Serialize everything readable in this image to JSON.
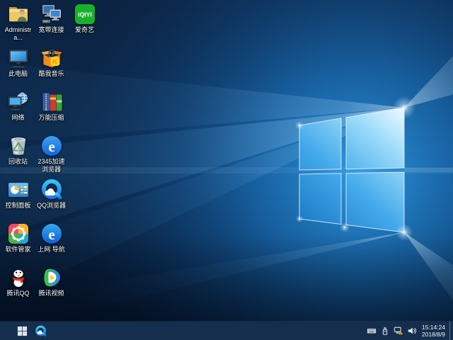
{
  "desktop": {
    "icons": [
      {
        "id": "user-folder",
        "label": "Administra...",
        "col": 0,
        "row": 0
      },
      {
        "id": "broadband",
        "label": "宽带连接",
        "col": 1,
        "row": 0
      },
      {
        "id": "iqiyi",
        "label": "爱奇艺",
        "badge_text": "iQIYI",
        "col": 2,
        "row": 0
      },
      {
        "id": "this-pc",
        "label": "此电脑",
        "col": 0,
        "row": 1
      },
      {
        "id": "kuwo-music",
        "label": "酷我音乐",
        "badge_text": "K",
        "col": 1,
        "row": 1
      },
      {
        "id": "network",
        "label": "网络",
        "col": 0,
        "row": 2
      },
      {
        "id": "wanneng-zip",
        "label": "万能压缩",
        "col": 1,
        "row": 2
      },
      {
        "id": "recycle-bin",
        "label": "回收站",
        "col": 0,
        "row": 3
      },
      {
        "id": "browser-2345",
        "label": "2345加速浏览器",
        "badge_text": "e",
        "col": 1,
        "row": 3
      },
      {
        "id": "control-panel",
        "label": "控制面板",
        "col": 0,
        "row": 4
      },
      {
        "id": "qq-browser",
        "label": "QQ浏览器",
        "col": 1,
        "row": 4
      },
      {
        "id": "software-manager",
        "label": "软件管家",
        "col": 0,
        "row": 5
      },
      {
        "id": "web-nav",
        "label": "上网 导航",
        "badge_text": "e",
        "col": 1,
        "row": 5
      },
      {
        "id": "tencent-qq",
        "label": "腾讯QQ",
        "col": 0,
        "row": 6
      },
      {
        "id": "tencent-video",
        "label": "腾讯视频",
        "col": 1,
        "row": 6
      }
    ]
  },
  "taskbar": {
    "start_tooltip": "开始",
    "pinned": [
      {
        "id": "qq-browser-task",
        "icon": "qq-browser"
      }
    ],
    "tray": {
      "icons": [
        {
          "id": "touch-keyboard"
        },
        {
          "id": "usb-device"
        },
        {
          "id": "network-warning"
        },
        {
          "id": "volume"
        }
      ],
      "clock": {
        "time": "15:14:24",
        "date": "2018/8/9"
      }
    }
  },
  "colors": {
    "taskbar_bg": "#152e4d",
    "wallpaper_accent": "#1e83d6",
    "label_color": "#ffffff",
    "warning_yellow": "#f6c21e"
  }
}
